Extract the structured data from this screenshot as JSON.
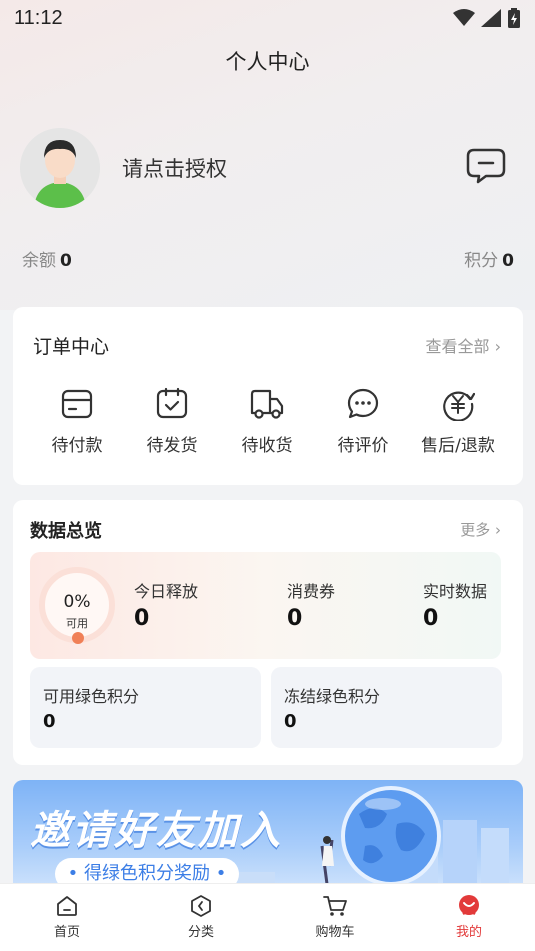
{
  "status": {
    "time": "11:12"
  },
  "header": {
    "title": "个人中心"
  },
  "profile": {
    "auth_text": "请点击授权"
  },
  "account": {
    "balance_label": "余额",
    "balance_value": "0",
    "points_label": "积分",
    "points_value": "0"
  },
  "orders": {
    "title": "订单中心",
    "view_all": "查看全部",
    "items": [
      {
        "label": "待付款",
        "icon": "wallet-icon"
      },
      {
        "label": "待发货",
        "icon": "box-check-icon"
      },
      {
        "label": "待收货",
        "icon": "truck-icon"
      },
      {
        "label": "待评价",
        "icon": "chat-bubble-icon"
      },
      {
        "label": "售后/退款",
        "icon": "refund-icon"
      }
    ]
  },
  "overview": {
    "title": "数据总览",
    "more": "更多",
    "percent": "0%",
    "percent_label": "可用",
    "stats": [
      {
        "label": "今日释放",
        "value": "0"
      },
      {
        "label": "消费券",
        "value": "0"
      },
      {
        "label": "实时数据",
        "value": "0"
      }
    ],
    "green_points": [
      {
        "label": "可用绿色积分",
        "value": "0"
      },
      {
        "label": "冻结绿色积分",
        "value": "0"
      }
    ]
  },
  "invite": {
    "title": "邀请好友加入",
    "subtitle": "• 得绿色积分奖励 •"
  },
  "tabbar": {
    "items": [
      {
        "label": "首页",
        "icon": "home-icon"
      },
      {
        "label": "分类",
        "icon": "category-icon"
      },
      {
        "label": "购物车",
        "icon": "cart-icon"
      },
      {
        "label": "我的",
        "icon": "profile-icon"
      }
    ],
    "active": "我的"
  },
  "colors": {
    "accent": "#e23a3a",
    "link": "#3c7ee6",
    "ring_dot": "#f08057"
  }
}
